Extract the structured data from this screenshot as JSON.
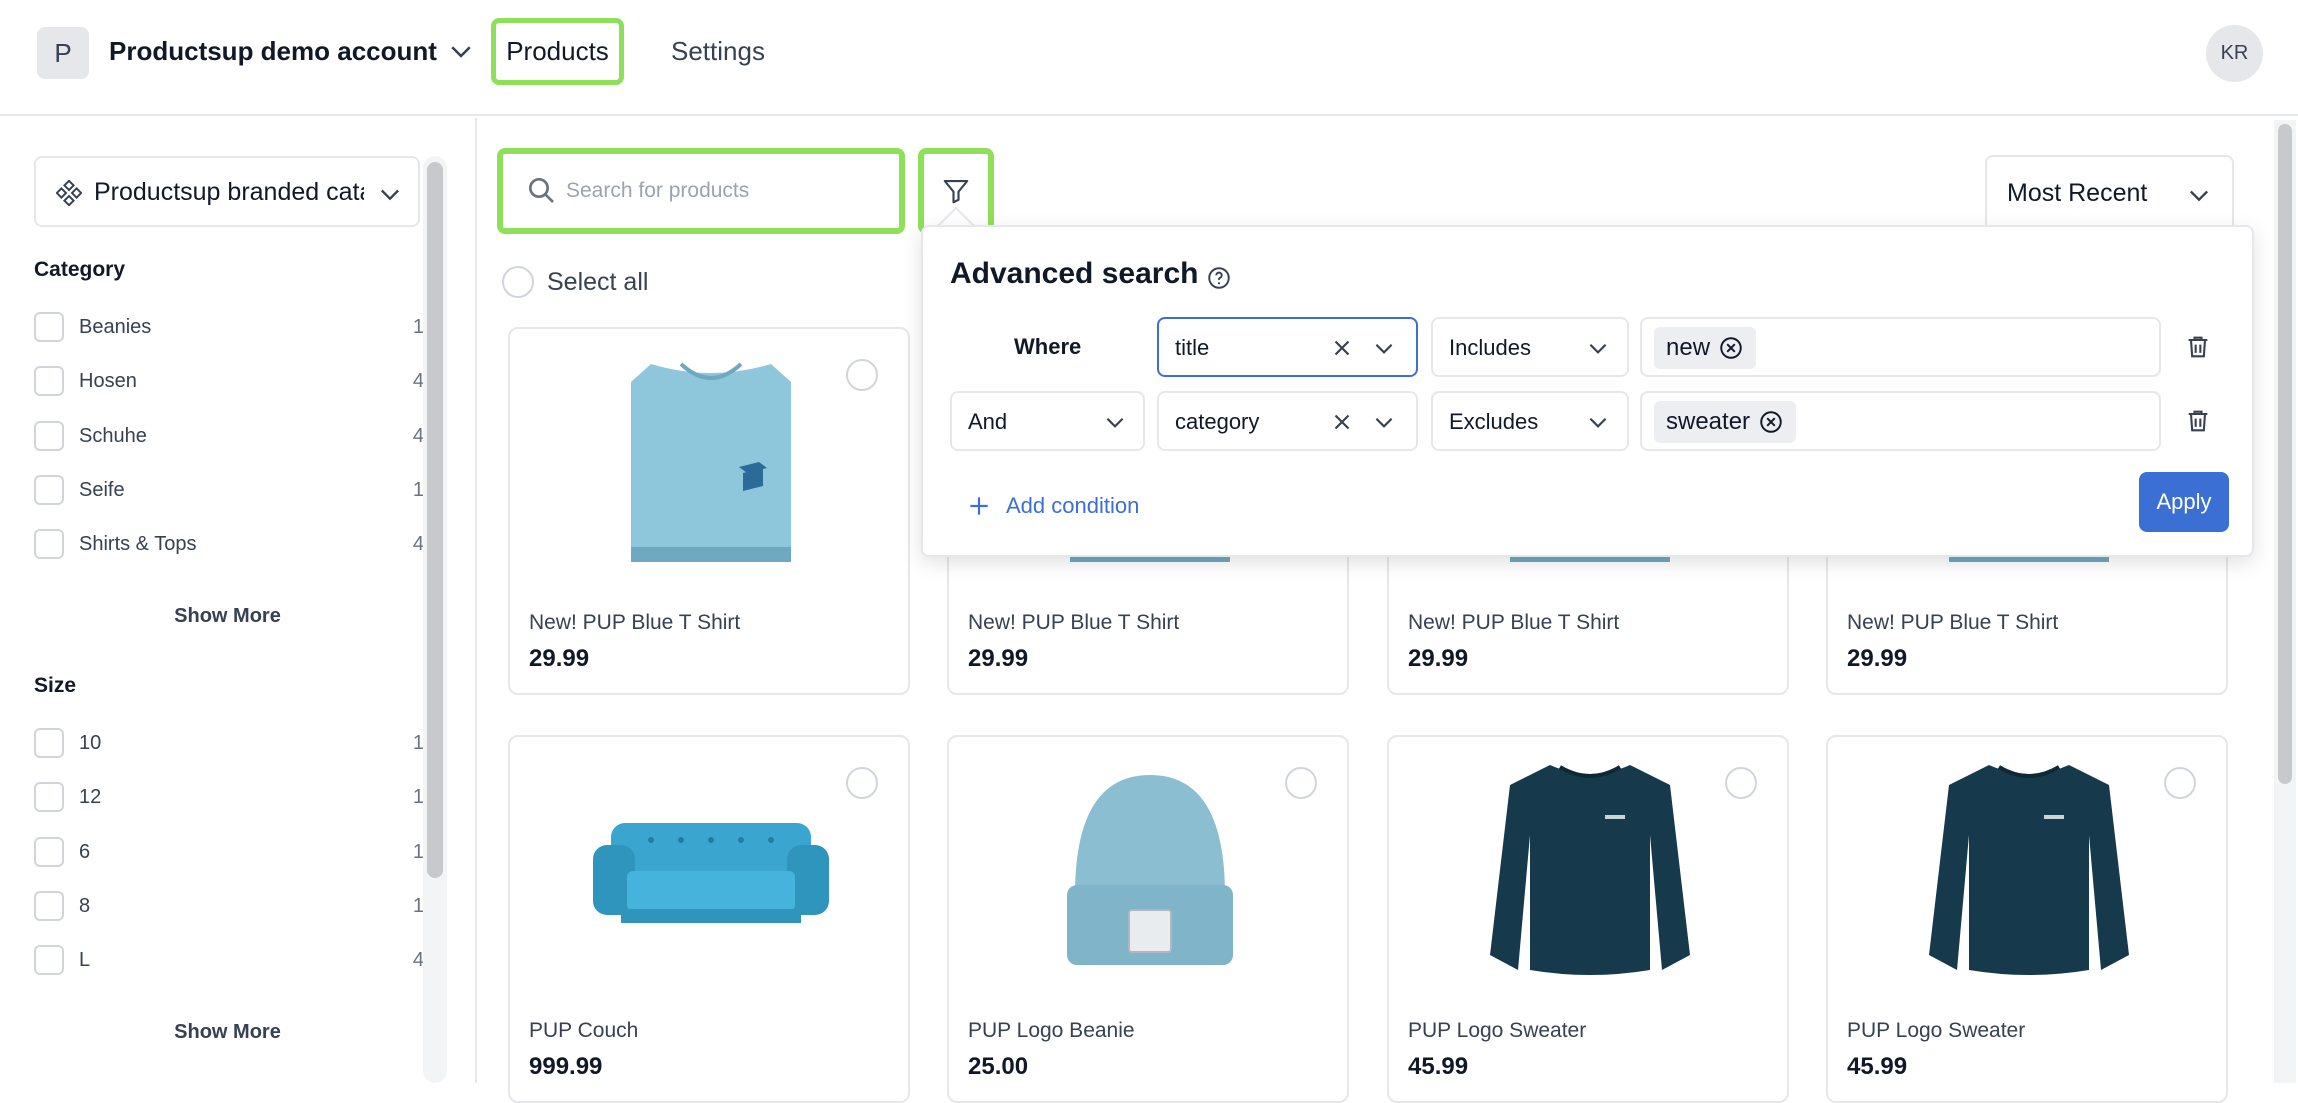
{
  "header": {
    "account_initial": "P",
    "account_name": "Productsup demo account",
    "nav": {
      "products": "Products",
      "settings": "Settings"
    },
    "user_initials": "KR"
  },
  "sidebar": {
    "catalog": "Productsup branded catalog",
    "category": {
      "title": "Category",
      "items": [
        {
          "label": "Beanies",
          "count": "1"
        },
        {
          "label": "Hosen",
          "count": "4"
        },
        {
          "label": "Schuhe",
          "count": "4"
        },
        {
          "label": "Seife",
          "count": "1"
        },
        {
          "label": "Shirts & Tops",
          "count": "4"
        }
      ],
      "show_more": "Show More"
    },
    "size": {
      "title": "Size",
      "items": [
        {
          "label": "10",
          "count": "1"
        },
        {
          "label": "12",
          "count": "1"
        },
        {
          "label": "6",
          "count": "1"
        },
        {
          "label": "8",
          "count": "1"
        },
        {
          "label": "L",
          "count": "4"
        }
      ],
      "show_more": "Show More"
    }
  },
  "toolbar": {
    "search_placeholder": "Search for products",
    "sort": "Most Recent",
    "select_all": "Select all"
  },
  "advanced_search": {
    "title": "Advanced search",
    "rows": [
      {
        "connector": "Where",
        "field": "title",
        "operator": "Includes",
        "value": "new"
      },
      {
        "connector": "And",
        "field": "category",
        "operator": "Excludes",
        "value": "sweater"
      }
    ],
    "add_condition": "Add condition",
    "apply": "Apply"
  },
  "products": [
    {
      "name": "New! PUP Blue T Shirt",
      "price": "29.99",
      "icon": "tshirt"
    },
    {
      "name": "New! PUP Blue T Shirt",
      "price": "29.99",
      "icon": "tshirt"
    },
    {
      "name": "New! PUP Blue T Shirt",
      "price": "29.99",
      "icon": "tshirt"
    },
    {
      "name": "New! PUP Blue T Shirt",
      "price": "29.99",
      "icon": "tshirt"
    },
    {
      "name": "PUP Couch",
      "price": "999.99",
      "icon": "couch"
    },
    {
      "name": "PUP Logo Beanie",
      "price": "25.00",
      "icon": "beanie"
    },
    {
      "name": "PUP Logo Sweater",
      "price": "45.99",
      "icon": "sweater"
    },
    {
      "name": "PUP Logo Sweater",
      "price": "45.99",
      "icon": "sweater"
    }
  ],
  "colors": {
    "highlight": "#8ee05a",
    "primary": "#3b6fd4",
    "tshirt": "#8ec6dc",
    "sweater": "#163a4c",
    "couch": "#3aa6cf",
    "beanie": "#7fb4c9"
  }
}
